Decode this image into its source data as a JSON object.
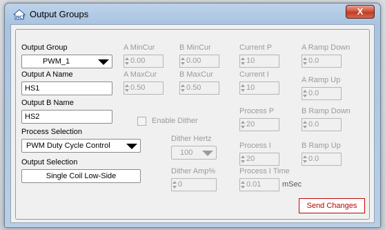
{
  "window": {
    "title": "Output Groups",
    "close_label": "X"
  },
  "output_group": {
    "label": "Output Group",
    "value": "PWM_1"
  },
  "output_a": {
    "label": "Output A Name",
    "value": "HS1"
  },
  "output_b": {
    "label": "Output B Name",
    "value": "HS2"
  },
  "process_selection": {
    "label": "Process Selection",
    "value": "PWM Duty Cycle Control"
  },
  "output_selection": {
    "label": "Output Selection",
    "value": "Single Coil Low-Side"
  },
  "enable_dither": {
    "label": "Enable Dither",
    "checked": false
  },
  "dither_hertz": {
    "label": "Dither Hertz",
    "value": "100"
  },
  "dither_amp": {
    "label": "Dither Amp%",
    "value": "0"
  },
  "a_mincur": {
    "label": "A MinCur",
    "value": "0.00"
  },
  "b_mincur": {
    "label": "B MinCur",
    "value": "0.00"
  },
  "a_maxcur": {
    "label": "A MaxCur",
    "value": "0.50"
  },
  "b_maxcur": {
    "label": "B MaxCur",
    "value": "0.50"
  },
  "current_p": {
    "label": "Current P",
    "value": "10"
  },
  "current_i": {
    "label": "Current I",
    "value": "10"
  },
  "process_p": {
    "label": "Process P",
    "value": "20"
  },
  "process_i": {
    "label": "Process I",
    "value": "20"
  },
  "process_i_time": {
    "label": "Process I Time",
    "value": "0.01",
    "unit": "mSec"
  },
  "a_ramp_down": {
    "label": "A Ramp Down",
    "value": "0.0"
  },
  "a_ramp_up": {
    "label": "A Ramp Up",
    "value": "0.0"
  },
  "b_ramp_down": {
    "label": "B Ramp Down",
    "value": "0.0"
  },
  "b_ramp_up": {
    "label": "B Ramp Up",
    "value": "0.0"
  },
  "send_button": {
    "label": "Send Changes"
  },
  "colors": {
    "send_accent": "#c00000",
    "disabled_text": "#9a9a9a",
    "titlebar": "#b9cfe6"
  }
}
